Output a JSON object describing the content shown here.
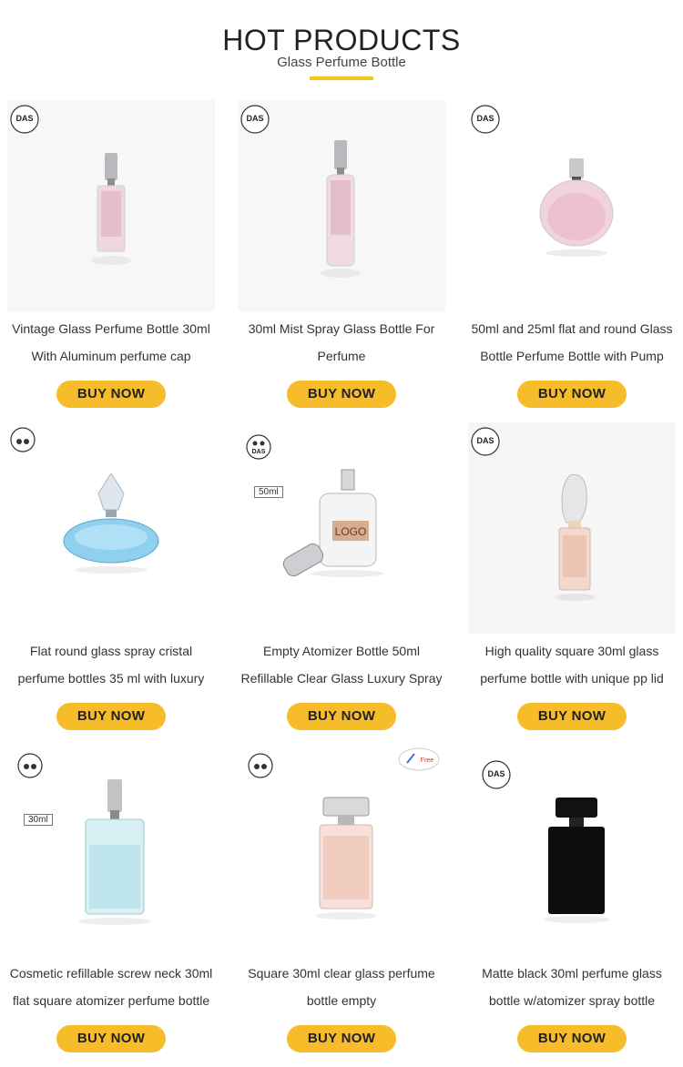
{
  "header": {
    "title": "HOT PRODUCTS",
    "subtitle": "Glass Perfume Bottle"
  },
  "colors": {
    "accent": "#f5c518",
    "button_bg": "#f7bc2a"
  },
  "badges": {
    "das": "DAS",
    "ml50": "50ml",
    "ml30": "30ml",
    "free": "Free",
    "logo": "LOGO"
  },
  "products": [
    {
      "line1": "Vintage Glass Perfume Bottle 30ml",
      "line2": "With Aluminum perfume cap",
      "button": "BUY NOW"
    },
    {
      "line1": "30ml Mist Spray Glass Bottle For",
      "line2": "Perfume",
      "button": "BUY NOW"
    },
    {
      "line1": "50ml and 25ml flat and round Glass",
      "line2": "Bottle Perfume Bottle with Pump",
      "button": "BUY NOW"
    },
    {
      "line1": "Flat round glass spray cristal",
      "line2": "perfume bottles 35 ml with luxury",
      "button": "BUY NOW"
    },
    {
      "line1": "Empty Atomizer Bottle 50ml",
      "line2": "Refillable Clear Glass Luxury Spray",
      "button": "BUY NOW"
    },
    {
      "line1": "High quality square 30ml glass",
      "line2": "perfume bottle with unique pp lid",
      "button": "BUY NOW"
    },
    {
      "line1": "Cosmetic refillable screw neck 30ml",
      "line2": "flat square atomizer perfume bottle",
      "button": "BUY NOW"
    },
    {
      "line1": "Square 30ml clear glass perfume",
      "line2": "bottle empty",
      "button": "BUY NOW"
    },
    {
      "line1": "Matte black 30ml perfume glass",
      "line2": "bottle w/atomizer spray bottle",
      "button": "BUY NOW"
    }
  ]
}
